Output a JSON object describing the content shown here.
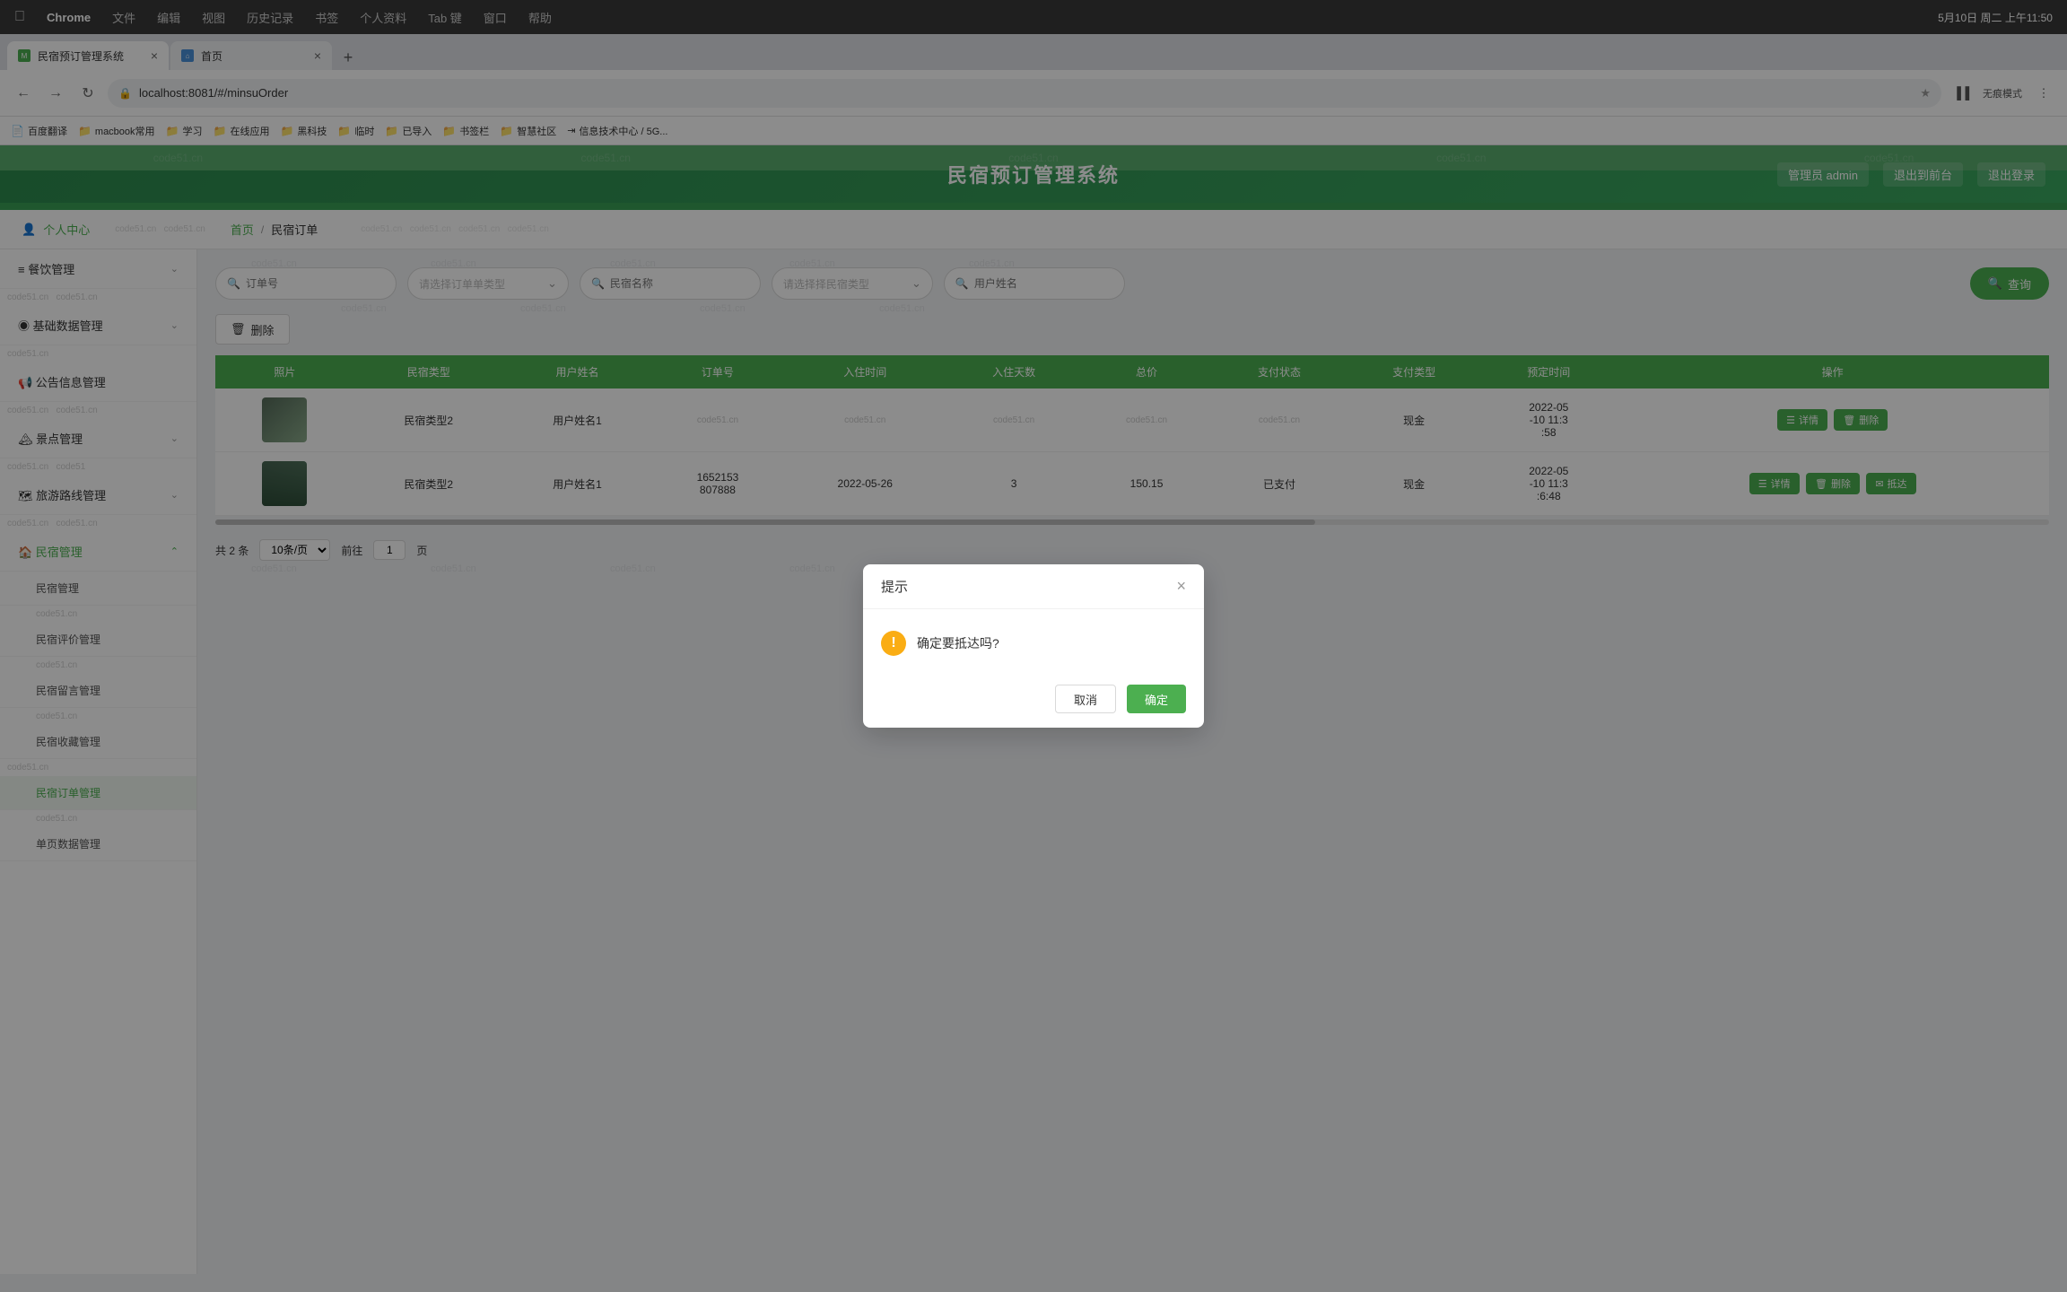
{
  "macos": {
    "brand": "Chrome",
    "menu_items": [
      "文件",
      "编辑",
      "视图",
      "历史记录",
      "书签",
      "个人资料",
      "Tab 键",
      "窗口",
      "帮助"
    ],
    "time": "5月10日 周二 上午11:50"
  },
  "browser": {
    "tab1_label": "民宿预订管理系统",
    "tab2_label": "首页",
    "address": "localhost:8081/#/minsuOrder",
    "mode_label": "无痕模式"
  },
  "bookmarks": [
    {
      "label": "百度翻译"
    },
    {
      "label": "macbook常用"
    },
    {
      "label": "学习"
    },
    {
      "label": "在线应用"
    },
    {
      "label": "黑科技"
    },
    {
      "label": "临时"
    },
    {
      "label": "已导入"
    },
    {
      "label": "书签栏"
    },
    {
      "label": "智慧社区"
    },
    {
      "label": "信息技术中心 / 5G..."
    }
  ],
  "app": {
    "title": "民宿预订管理系统",
    "admin_label": "管理员 admin",
    "back_to_frontend": "退出到前台",
    "logout": "退出登录"
  },
  "watermark_text": "code51.cn",
  "breadcrumb": {
    "home": "首页",
    "separator": "/",
    "current": "民宿订单",
    "user_icon": "👤",
    "personal_center": "个人中心"
  },
  "sidebar": {
    "items": [
      {
        "label": "餐饮管理",
        "icon": "≡",
        "has_sub": true
      },
      {
        "label": "基础数据管理",
        "icon": "◉",
        "has_sub": true
      },
      {
        "label": "公告信息管理",
        "icon": "📢",
        "has_sub": false
      },
      {
        "label": "景点管理",
        "icon": "🏔",
        "has_sub": true
      },
      {
        "label": "旅游路线管理",
        "icon": "🗺",
        "has_sub": true
      },
      {
        "label": "民宿管理",
        "icon": "🏠",
        "has_sub": true,
        "expanded": true
      }
    ],
    "sub_items": [
      {
        "label": "民宿管理",
        "active": false
      },
      {
        "label": "民宿评价管理",
        "active": false
      },
      {
        "label": "民宿留言管理",
        "active": false
      },
      {
        "label": "民宿收藏管理",
        "active": false
      },
      {
        "label": "民宿订单管理",
        "active": true
      },
      {
        "label": "单页数据管理",
        "active": false
      }
    ]
  },
  "filter": {
    "order_no_placeholder": "订单号",
    "order_type_placeholder": "请选择订单单类型",
    "minshu_name_placeholder": "民宿名称",
    "minshu_type_placeholder": "请选择择民宿类型",
    "user_name_placeholder": "用户姓名",
    "query_btn": "查询",
    "delete_btn": "删除"
  },
  "table": {
    "columns": [
      "照片",
      "民宿类型",
      "用户姓名",
      "订单号",
      "入住时间",
      "入住天数",
      "总价",
      "支付状态",
      "支付类型",
      "预定时间",
      "操作"
    ],
    "rows": [
      {
        "photo": "mountain1",
        "minshu_type": "民宿类型2",
        "user_name": "用户姓名1",
        "order_no": "",
        "checkin_time": "",
        "days": "",
        "total_price": "",
        "pay_status": "",
        "pay_type": "现金",
        "booking_time": "2022-05-10 11:3:58",
        "ops": [
          "详情",
          "删除"
        ]
      },
      {
        "photo": "mountain2",
        "minshu_type": "民宿类型2",
        "user_name": "用户姓名1",
        "order_no": "1652153807888",
        "checkin_time": "2022-05-26",
        "days": "3",
        "total_price": "150.15",
        "pay_status": "已支付",
        "pay_type": "现金",
        "booking_time": "2022-05-10 11:3:6:48",
        "ops": [
          "详情",
          "删除",
          "抵达"
        ]
      }
    ]
  },
  "pagination": {
    "total_label": "共 2 条",
    "per_page": "10条/页",
    "prev_label": "前往",
    "page_num": "1",
    "page_unit": "页"
  },
  "modal": {
    "title": "提示",
    "message": "确定要抵达吗?",
    "cancel_label": "取消",
    "confirm_label": "确定"
  },
  "op_labels": {
    "detail": "详情",
    "delete": "删除",
    "arrive": "抵达"
  }
}
